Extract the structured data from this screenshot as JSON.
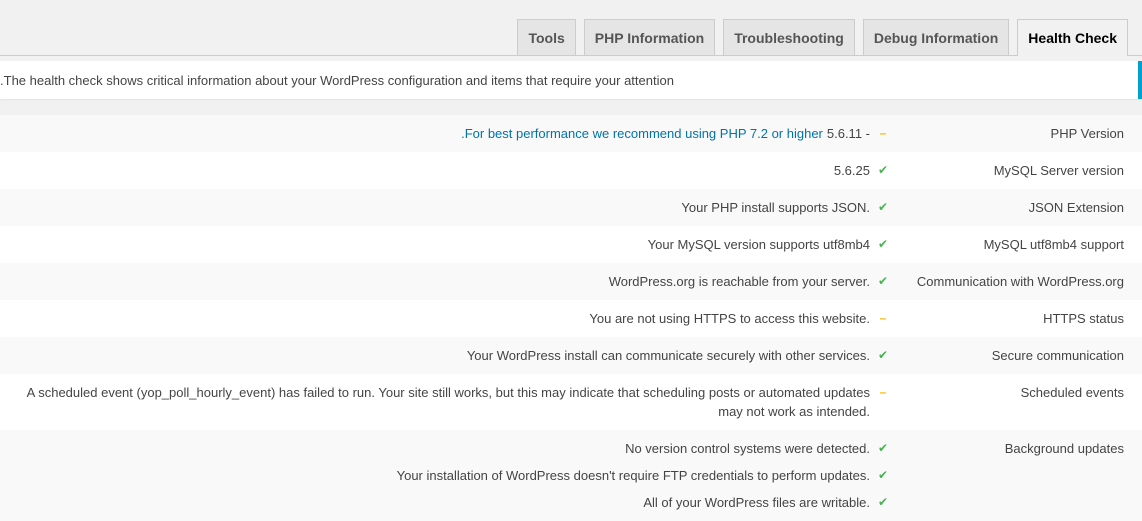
{
  "tabs": [
    {
      "label": "Tools",
      "active": false
    },
    {
      "label": "PHP Information",
      "active": false
    },
    {
      "label": "Troubleshooting",
      "active": false
    },
    {
      "label": "Debug Information",
      "active": false
    },
    {
      "label": "Health Check",
      "active": true
    }
  ],
  "notice": {
    "text": "The health check shows critical information about your WordPress configuration and items that require your attention."
  },
  "colors": {
    "ok": "#46b450",
    "warning": "#ffb900",
    "link": "#0073aa",
    "notice_border": "#00a0d2"
  },
  "rows": [
    {
      "label": "PHP Version",
      "items": [
        {
          "status": "warning",
          "icon": "minus-icon",
          "text": "5.6.11 - ",
          "link": "For best performance we recommend using PHP 7.2 or higher."
        }
      ]
    },
    {
      "label": "MySQL Server version",
      "items": [
        {
          "status": "ok",
          "icon": "check-icon",
          "text": "5.6.25"
        }
      ]
    },
    {
      "label": "JSON Extension",
      "items": [
        {
          "status": "ok",
          "icon": "check-icon",
          "text": "Your PHP install supports JSON."
        }
      ]
    },
    {
      "label": "MySQL utf8mb4 support",
      "items": [
        {
          "status": "ok",
          "icon": "check-icon",
          "text": "Your MySQL version supports utf8mb4"
        }
      ]
    },
    {
      "label": "Communication with WordPress.org",
      "items": [
        {
          "status": "ok",
          "icon": "check-icon",
          "text": "WordPress.org is reachable from your server."
        }
      ]
    },
    {
      "label": "HTTPS status",
      "items": [
        {
          "status": "warning",
          "icon": "minus-icon",
          "text": "You are not using HTTPS to access this website."
        }
      ]
    },
    {
      "label": "Secure communication",
      "items": [
        {
          "status": "ok",
          "icon": "check-icon",
          "text": "Your WordPress install can communicate securely with other services."
        }
      ]
    },
    {
      "label": "Scheduled events",
      "items": [
        {
          "status": "warning",
          "icon": "minus-icon",
          "text": "A scheduled event (yop_poll_hourly_event) has failed to run. Your site still works, but this may indicate that scheduling posts or automated updates may not work as intended."
        }
      ]
    },
    {
      "label": "Background updates",
      "items": [
        {
          "status": "ok",
          "icon": "check-icon",
          "text": "No version control systems were detected."
        },
        {
          "status": "ok",
          "icon": "check-icon",
          "text": "Your installation of WordPress doesn't require FTP credentials to perform updates."
        },
        {
          "status": "ok",
          "icon": "check-icon",
          "text": "All of your WordPress files are writable."
        }
      ]
    }
  ]
}
